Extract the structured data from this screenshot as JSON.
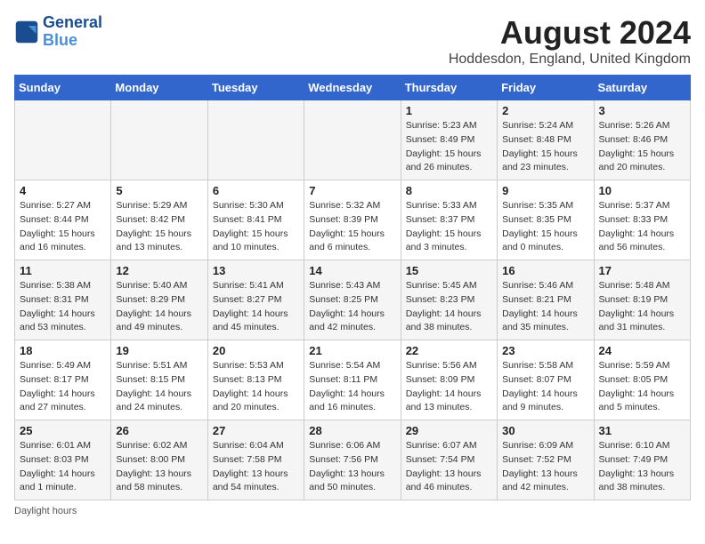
{
  "header": {
    "logo_line1": "General",
    "logo_line2": "Blue",
    "title": "August 2024",
    "subtitle": "Hoddesdon, England, United Kingdom"
  },
  "days_of_week": [
    "Sunday",
    "Monday",
    "Tuesday",
    "Wednesday",
    "Thursday",
    "Friday",
    "Saturday"
  ],
  "weeks": [
    {
      "days": [
        {
          "num": "",
          "info": ""
        },
        {
          "num": "",
          "info": ""
        },
        {
          "num": "",
          "info": ""
        },
        {
          "num": "",
          "info": ""
        },
        {
          "num": "1",
          "info": "Sunrise: 5:23 AM\nSunset: 8:49 PM\nDaylight: 15 hours\nand 26 minutes."
        },
        {
          "num": "2",
          "info": "Sunrise: 5:24 AM\nSunset: 8:48 PM\nDaylight: 15 hours\nand 23 minutes."
        },
        {
          "num": "3",
          "info": "Sunrise: 5:26 AM\nSunset: 8:46 PM\nDaylight: 15 hours\nand 20 minutes."
        }
      ]
    },
    {
      "days": [
        {
          "num": "4",
          "info": "Sunrise: 5:27 AM\nSunset: 8:44 PM\nDaylight: 15 hours\nand 16 minutes."
        },
        {
          "num": "5",
          "info": "Sunrise: 5:29 AM\nSunset: 8:42 PM\nDaylight: 15 hours\nand 13 minutes."
        },
        {
          "num": "6",
          "info": "Sunrise: 5:30 AM\nSunset: 8:41 PM\nDaylight: 15 hours\nand 10 minutes."
        },
        {
          "num": "7",
          "info": "Sunrise: 5:32 AM\nSunset: 8:39 PM\nDaylight: 15 hours\nand 6 minutes."
        },
        {
          "num": "8",
          "info": "Sunrise: 5:33 AM\nSunset: 8:37 PM\nDaylight: 15 hours\nand 3 minutes."
        },
        {
          "num": "9",
          "info": "Sunrise: 5:35 AM\nSunset: 8:35 PM\nDaylight: 15 hours\nand 0 minutes."
        },
        {
          "num": "10",
          "info": "Sunrise: 5:37 AM\nSunset: 8:33 PM\nDaylight: 14 hours\nand 56 minutes."
        }
      ]
    },
    {
      "days": [
        {
          "num": "11",
          "info": "Sunrise: 5:38 AM\nSunset: 8:31 PM\nDaylight: 14 hours\nand 53 minutes."
        },
        {
          "num": "12",
          "info": "Sunrise: 5:40 AM\nSunset: 8:29 PM\nDaylight: 14 hours\nand 49 minutes."
        },
        {
          "num": "13",
          "info": "Sunrise: 5:41 AM\nSunset: 8:27 PM\nDaylight: 14 hours\nand 45 minutes."
        },
        {
          "num": "14",
          "info": "Sunrise: 5:43 AM\nSunset: 8:25 PM\nDaylight: 14 hours\nand 42 minutes."
        },
        {
          "num": "15",
          "info": "Sunrise: 5:45 AM\nSunset: 8:23 PM\nDaylight: 14 hours\nand 38 minutes."
        },
        {
          "num": "16",
          "info": "Sunrise: 5:46 AM\nSunset: 8:21 PM\nDaylight: 14 hours\nand 35 minutes."
        },
        {
          "num": "17",
          "info": "Sunrise: 5:48 AM\nSunset: 8:19 PM\nDaylight: 14 hours\nand 31 minutes."
        }
      ]
    },
    {
      "days": [
        {
          "num": "18",
          "info": "Sunrise: 5:49 AM\nSunset: 8:17 PM\nDaylight: 14 hours\nand 27 minutes."
        },
        {
          "num": "19",
          "info": "Sunrise: 5:51 AM\nSunset: 8:15 PM\nDaylight: 14 hours\nand 24 minutes."
        },
        {
          "num": "20",
          "info": "Sunrise: 5:53 AM\nSunset: 8:13 PM\nDaylight: 14 hours\nand 20 minutes."
        },
        {
          "num": "21",
          "info": "Sunrise: 5:54 AM\nSunset: 8:11 PM\nDaylight: 14 hours\nand 16 minutes."
        },
        {
          "num": "22",
          "info": "Sunrise: 5:56 AM\nSunset: 8:09 PM\nDaylight: 14 hours\nand 13 minutes."
        },
        {
          "num": "23",
          "info": "Sunrise: 5:58 AM\nSunset: 8:07 PM\nDaylight: 14 hours\nand 9 minutes."
        },
        {
          "num": "24",
          "info": "Sunrise: 5:59 AM\nSunset: 8:05 PM\nDaylight: 14 hours\nand 5 minutes."
        }
      ]
    },
    {
      "days": [
        {
          "num": "25",
          "info": "Sunrise: 6:01 AM\nSunset: 8:03 PM\nDaylight: 14 hours\nand 1 minute."
        },
        {
          "num": "26",
          "info": "Sunrise: 6:02 AM\nSunset: 8:00 PM\nDaylight: 13 hours\nand 58 minutes."
        },
        {
          "num": "27",
          "info": "Sunrise: 6:04 AM\nSunset: 7:58 PM\nDaylight: 13 hours\nand 54 minutes."
        },
        {
          "num": "28",
          "info": "Sunrise: 6:06 AM\nSunset: 7:56 PM\nDaylight: 13 hours\nand 50 minutes."
        },
        {
          "num": "29",
          "info": "Sunrise: 6:07 AM\nSunset: 7:54 PM\nDaylight: 13 hours\nand 46 minutes."
        },
        {
          "num": "30",
          "info": "Sunrise: 6:09 AM\nSunset: 7:52 PM\nDaylight: 13 hours\nand 42 minutes."
        },
        {
          "num": "31",
          "info": "Sunrise: 6:10 AM\nSunset: 7:49 PM\nDaylight: 13 hours\nand 38 minutes."
        }
      ]
    }
  ],
  "footer": "Daylight hours"
}
